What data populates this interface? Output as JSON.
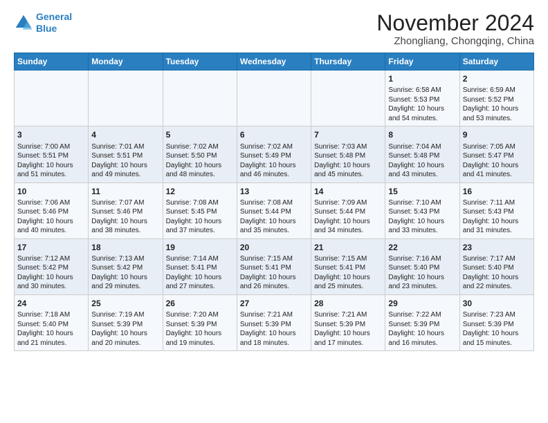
{
  "logo": {
    "line1": "General",
    "line2": "Blue"
  },
  "title": "November 2024",
  "subtitle": "Zhongliang, Chongqing, China",
  "days_of_week": [
    "Sunday",
    "Monday",
    "Tuesday",
    "Wednesday",
    "Thursday",
    "Friday",
    "Saturday"
  ],
  "weeks": [
    [
      {
        "day": "",
        "content": ""
      },
      {
        "day": "",
        "content": ""
      },
      {
        "day": "",
        "content": ""
      },
      {
        "day": "",
        "content": ""
      },
      {
        "day": "",
        "content": ""
      },
      {
        "day": "1",
        "content": "Sunrise: 6:58 AM\nSunset: 5:53 PM\nDaylight: 10 hours\nand 54 minutes."
      },
      {
        "day": "2",
        "content": "Sunrise: 6:59 AM\nSunset: 5:52 PM\nDaylight: 10 hours\nand 53 minutes."
      }
    ],
    [
      {
        "day": "3",
        "content": "Sunrise: 7:00 AM\nSunset: 5:51 PM\nDaylight: 10 hours\nand 51 minutes."
      },
      {
        "day": "4",
        "content": "Sunrise: 7:01 AM\nSunset: 5:51 PM\nDaylight: 10 hours\nand 49 minutes."
      },
      {
        "day": "5",
        "content": "Sunrise: 7:02 AM\nSunset: 5:50 PM\nDaylight: 10 hours\nand 48 minutes."
      },
      {
        "day": "6",
        "content": "Sunrise: 7:02 AM\nSunset: 5:49 PM\nDaylight: 10 hours\nand 46 minutes."
      },
      {
        "day": "7",
        "content": "Sunrise: 7:03 AM\nSunset: 5:48 PM\nDaylight: 10 hours\nand 45 minutes."
      },
      {
        "day": "8",
        "content": "Sunrise: 7:04 AM\nSunset: 5:48 PM\nDaylight: 10 hours\nand 43 minutes."
      },
      {
        "day": "9",
        "content": "Sunrise: 7:05 AM\nSunset: 5:47 PM\nDaylight: 10 hours\nand 41 minutes."
      }
    ],
    [
      {
        "day": "10",
        "content": "Sunrise: 7:06 AM\nSunset: 5:46 PM\nDaylight: 10 hours\nand 40 minutes."
      },
      {
        "day": "11",
        "content": "Sunrise: 7:07 AM\nSunset: 5:46 PM\nDaylight: 10 hours\nand 38 minutes."
      },
      {
        "day": "12",
        "content": "Sunrise: 7:08 AM\nSunset: 5:45 PM\nDaylight: 10 hours\nand 37 minutes."
      },
      {
        "day": "13",
        "content": "Sunrise: 7:08 AM\nSunset: 5:44 PM\nDaylight: 10 hours\nand 35 minutes."
      },
      {
        "day": "14",
        "content": "Sunrise: 7:09 AM\nSunset: 5:44 PM\nDaylight: 10 hours\nand 34 minutes."
      },
      {
        "day": "15",
        "content": "Sunrise: 7:10 AM\nSunset: 5:43 PM\nDaylight: 10 hours\nand 33 minutes."
      },
      {
        "day": "16",
        "content": "Sunrise: 7:11 AM\nSunset: 5:43 PM\nDaylight: 10 hours\nand 31 minutes."
      }
    ],
    [
      {
        "day": "17",
        "content": "Sunrise: 7:12 AM\nSunset: 5:42 PM\nDaylight: 10 hours\nand 30 minutes."
      },
      {
        "day": "18",
        "content": "Sunrise: 7:13 AM\nSunset: 5:42 PM\nDaylight: 10 hours\nand 29 minutes."
      },
      {
        "day": "19",
        "content": "Sunrise: 7:14 AM\nSunset: 5:41 PM\nDaylight: 10 hours\nand 27 minutes."
      },
      {
        "day": "20",
        "content": "Sunrise: 7:15 AM\nSunset: 5:41 PM\nDaylight: 10 hours\nand 26 minutes."
      },
      {
        "day": "21",
        "content": "Sunrise: 7:15 AM\nSunset: 5:41 PM\nDaylight: 10 hours\nand 25 minutes."
      },
      {
        "day": "22",
        "content": "Sunrise: 7:16 AM\nSunset: 5:40 PM\nDaylight: 10 hours\nand 23 minutes."
      },
      {
        "day": "23",
        "content": "Sunrise: 7:17 AM\nSunset: 5:40 PM\nDaylight: 10 hours\nand 22 minutes."
      }
    ],
    [
      {
        "day": "24",
        "content": "Sunrise: 7:18 AM\nSunset: 5:40 PM\nDaylight: 10 hours\nand 21 minutes."
      },
      {
        "day": "25",
        "content": "Sunrise: 7:19 AM\nSunset: 5:39 PM\nDaylight: 10 hours\nand 20 minutes."
      },
      {
        "day": "26",
        "content": "Sunrise: 7:20 AM\nSunset: 5:39 PM\nDaylight: 10 hours\nand 19 minutes."
      },
      {
        "day": "27",
        "content": "Sunrise: 7:21 AM\nSunset: 5:39 PM\nDaylight: 10 hours\nand 18 minutes."
      },
      {
        "day": "28",
        "content": "Sunrise: 7:21 AM\nSunset: 5:39 PM\nDaylight: 10 hours\nand 17 minutes."
      },
      {
        "day": "29",
        "content": "Sunrise: 7:22 AM\nSunset: 5:39 PM\nDaylight: 10 hours\nand 16 minutes."
      },
      {
        "day": "30",
        "content": "Sunrise: 7:23 AM\nSunset: 5:39 PM\nDaylight: 10 hours\nand 15 minutes."
      }
    ]
  ]
}
